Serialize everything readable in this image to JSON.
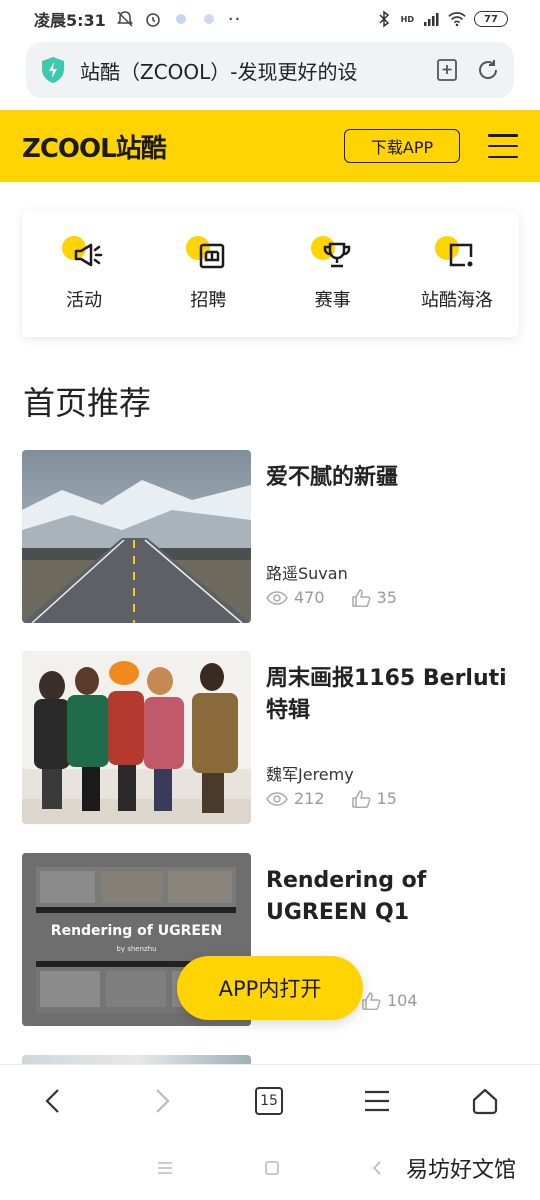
{
  "status_bar": {
    "time": "凌晨5:31",
    "battery": "77",
    "network_label": "HD"
  },
  "address_bar": {
    "title": "站酷（ZCOOL）-发现更好的设"
  },
  "header": {
    "logo_text": "ZCOOL站酷",
    "download_label": "下载APP"
  },
  "quick_nav": [
    {
      "label": "活动",
      "icon": "megaphone-icon"
    },
    {
      "label": "招聘",
      "icon": "briefcase-icon"
    },
    {
      "label": "赛事",
      "icon": "trophy-icon"
    },
    {
      "label": "站酷海洛",
      "icon": "image-frame-icon"
    }
  ],
  "section": {
    "title": "首页推荐"
  },
  "feed": [
    {
      "title": "爱不腻的新疆",
      "author": "路遥Suvan",
      "views": "470",
      "likes": "35"
    },
    {
      "title": "周末画报1165 Berluti特辑",
      "author": "魏军Jeremy",
      "views": "212",
      "likes": "15"
    },
    {
      "title": "Rendering of UGREEN Q1",
      "author": "",
      "views": "",
      "likes": "104",
      "thumb_caption": "Rendering of UGREEN",
      "thumb_sub": "by shenzhu"
    }
  ],
  "float_button": {
    "label": "APP内打开"
  },
  "browser_bar": {
    "tabs_count": "15"
  },
  "watermark": "易坊好文馆",
  "colors": {
    "brand_yellow": "#ffd400",
    "text_dark": "#222222",
    "text_muted": "#999999"
  }
}
